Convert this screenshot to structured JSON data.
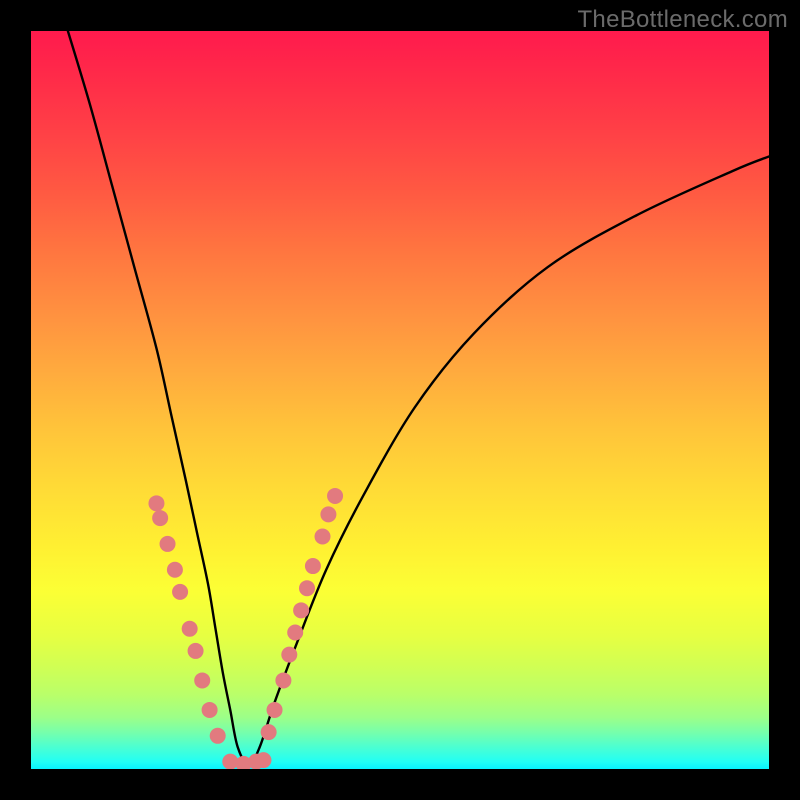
{
  "watermark": {
    "text": "TheBottleneck.com"
  },
  "chart_data": {
    "type": "line",
    "title": "",
    "xlabel": "",
    "ylabel": "",
    "xlim": [
      0,
      100
    ],
    "ylim": [
      0,
      100
    ],
    "grid": false,
    "series": [
      {
        "name": "bottleneck-curve",
        "color": "#000000",
        "x": [
          5,
          8,
          11,
          14,
          17,
          19,
          21,
          22.5,
          24,
          25,
          26,
          27,
          28,
          29.5,
          31,
          33,
          36,
          40,
          45,
          52,
          60,
          70,
          82,
          95,
          100
        ],
        "y": [
          100,
          90,
          79,
          68,
          57,
          48,
          39,
          32,
          25,
          19,
          13,
          8,
          3,
          0.5,
          3,
          9,
          17,
          27,
          37,
          49,
          59,
          68,
          75,
          81,
          83
        ]
      }
    ],
    "markers": [
      {
        "name": "curve-dots",
        "color": "#e27a7f",
        "radius_px": 8,
        "points": [
          {
            "x": 17.0,
            "y": 36.0
          },
          {
            "x": 17.5,
            "y": 34.0
          },
          {
            "x": 18.5,
            "y": 30.5
          },
          {
            "x": 19.5,
            "y": 27.0
          },
          {
            "x": 20.2,
            "y": 24.0
          },
          {
            "x": 21.5,
            "y": 19.0
          },
          {
            "x": 22.3,
            "y": 16.0
          },
          {
            "x": 23.2,
            "y": 12.0
          },
          {
            "x": 24.2,
            "y": 8.0
          },
          {
            "x": 25.3,
            "y": 4.5
          },
          {
            "x": 27.0,
            "y": 1.0
          },
          {
            "x": 28.8,
            "y": 0.7
          },
          {
            "x": 30.5,
            "y": 1.0
          },
          {
            "x": 31.5,
            "y": 1.2
          },
          {
            "x": 32.2,
            "y": 5.0
          },
          {
            "x": 33.0,
            "y": 8.0
          },
          {
            "x": 34.2,
            "y": 12.0
          },
          {
            "x": 35.0,
            "y": 15.5
          },
          {
            "x": 35.8,
            "y": 18.5
          },
          {
            "x": 36.6,
            "y": 21.5
          },
          {
            "x": 37.4,
            "y": 24.5
          },
          {
            "x": 38.2,
            "y": 27.5
          },
          {
            "x": 39.5,
            "y": 31.5
          },
          {
            "x": 40.3,
            "y": 34.5
          },
          {
            "x": 41.2,
            "y": 37.0
          }
        ]
      }
    ]
  }
}
